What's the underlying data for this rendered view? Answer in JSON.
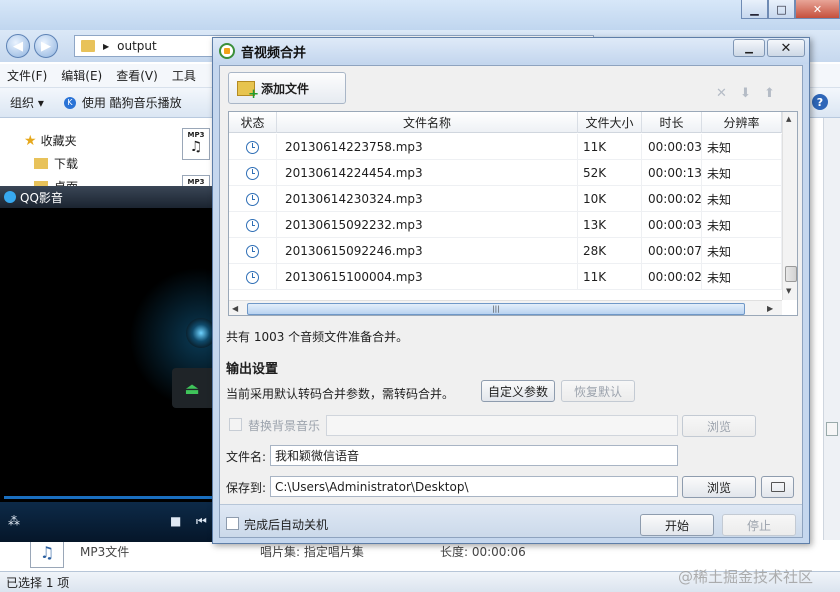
{
  "explorer": {
    "address": "output",
    "menu": [
      "文件(F)",
      "编辑(E)",
      "查看(V)",
      "工具"
    ],
    "toolbar": {
      "organize": "组织",
      "play_with": "使用 酷狗音乐播放"
    },
    "sidebar": {
      "favorites": "收藏夹",
      "downloads": "下载",
      "desktop": "桌面"
    },
    "file_type": "MP3文件",
    "album_label": "唱片集: 指定唱片集",
    "length_label": "长度: 00:00:06",
    "status": "已选择 1 项"
  },
  "player": {
    "title": "QQ影音"
  },
  "dialog": {
    "title": "音视频合并",
    "add_button": "添加文件",
    "columns": [
      "状态",
      "文件名称",
      "文件大小",
      "时长",
      "分辨率"
    ],
    "rows": [
      {
        "name": "20130614223758.mp3",
        "size": "11K",
        "duration": "00:00:03",
        "resolution": "未知"
      },
      {
        "name": "20130614224454.mp3",
        "size": "52K",
        "duration": "00:00:13",
        "resolution": "未知"
      },
      {
        "name": "20130614230324.mp3",
        "size": "10K",
        "duration": "00:00:02",
        "resolution": "未知"
      },
      {
        "name": "20130615092232.mp3",
        "size": "13K",
        "duration": "00:00:03",
        "resolution": "未知"
      },
      {
        "name": "20130615092246.mp3",
        "size": "28K",
        "duration": "00:00:07",
        "resolution": "未知"
      },
      {
        "name": "20130615100004.mp3",
        "size": "11K",
        "duration": "00:00:02",
        "resolution": "未知"
      }
    ],
    "summary": "共有 1003 个音频文件准备合并。",
    "output_heading": "输出设置",
    "output_desc": "当前采用默认转码合并参数，需转码合并。",
    "custom_params_button": "自定义参数",
    "restore_default_button": "恢复默认",
    "replace_bgm_label": "替换背景音乐",
    "browse_button": "浏览",
    "filename_label": "文件名:",
    "filename_value": "我和颖微信语音",
    "save_to_label": "保存到:",
    "save_to_value": "C:\\Users\\Administrator\\Desktop\\",
    "shutdown_label": "完成后自动关机",
    "start_button": "开始",
    "stop_button": "停止"
  },
  "watermark": "@稀土掘金技术社区"
}
